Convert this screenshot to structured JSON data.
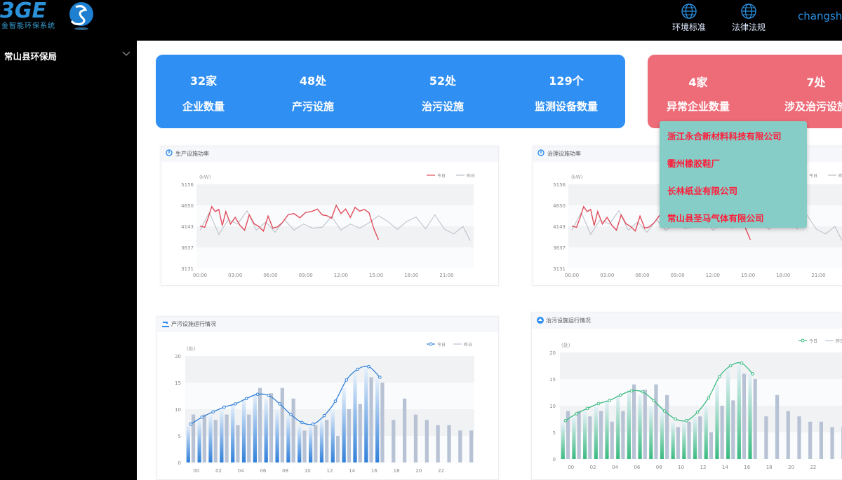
{
  "brand": {
    "logo_text": "3GE",
    "subtitle": "金智能环保系统"
  },
  "header": {
    "nav": [
      {
        "label": "环境标准",
        "icon": "globe-icon"
      },
      {
        "label": "法律法规",
        "icon": "globe-icon"
      }
    ],
    "user": "changsha"
  },
  "sidebar": {
    "items": [
      {
        "label": "常山县环保局",
        "icon": "chevron-down-icon"
      }
    ]
  },
  "summary": {
    "stats": [
      {
        "value": "32家",
        "label": "企业数量"
      },
      {
        "value": "48处",
        "label": "产污设施"
      },
      {
        "value": "52处",
        "label": "治污设施"
      },
      {
        "value": "129个",
        "label": "监测设备数量"
      }
    ],
    "alerts": [
      {
        "value": "4家",
        "label": "异常企业数量"
      },
      {
        "value": "7处",
        "label": "涉及治污设施"
      }
    ],
    "blue_color": "#2f8ff2",
    "red_color": "#ee6b78"
  },
  "abnormal_popup": {
    "items": [
      "浙江永合新材料科技有限公司",
      "衢州橡胶鞋厂",
      "长林纸业有限公司",
      "常山县圣马气体有限公司"
    ],
    "bg_color": "#86cdc7",
    "text_color": "#ff1d3a"
  },
  "panels": [
    {
      "title": "生产设施功率"
    },
    {
      "title": "治理设施功率"
    },
    {
      "title": "产污设施运行情况"
    },
    {
      "title": "治污设施运行情况"
    }
  ],
  "chart_data": [
    {
      "type": "line",
      "ylabel": "(kW)",
      "yticks": [
        5156,
        4650,
        4143,
        3637,
        3131
      ],
      "ylim": [
        3131,
        5156
      ],
      "xticks": [
        "00:00",
        "03:00",
        "06:00",
        "09:00",
        "12:00",
        "15:00",
        "18:00",
        "21:00"
      ],
      "xlim": [
        -0.3,
        23.3
      ],
      "series": [
        {
          "name": "今日",
          "color": "#e04c5c",
          "x": [
            0,
            0.4,
            0.7,
            1,
            1.3,
            1.6,
            1.9,
            2.2,
            2.6,
            3,
            3.4,
            3.8,
            4.2,
            4.6,
            5,
            5.4,
            5.8,
            6.2,
            6.6,
            7,
            7.5,
            8,
            8.5,
            9,
            9.5,
            10,
            10.4,
            10.8,
            11.2,
            11.6,
            12,
            12.4,
            12.8,
            13.2,
            13.6,
            14,
            14.4,
            14.8,
            15.2
          ],
          "values": [
            4150,
            4120,
            4350,
            4620,
            4500,
            4550,
            4160,
            4500,
            4200,
            4360,
            4170,
            4050,
            4420,
            4210,
            4140,
            4030,
            4390,
            4100,
            4130,
            4230,
            4420,
            4450,
            4350,
            4480,
            4500,
            4560,
            4420,
            4400,
            4340,
            4650,
            4450,
            4560,
            4360,
            4600,
            4510,
            4550,
            4470,
            4090,
            3820
          ]
        },
        {
          "name": "昨日",
          "color": "#b9bec6",
          "x": [
            0,
            0.8,
            1.6,
            2.4,
            3.2,
            4,
            4.8,
            5.6,
            6.4,
            7.2,
            8,
            8.8,
            9.6,
            10.4,
            11.2,
            12,
            12.8,
            13.6,
            14.4,
            15.2,
            16,
            16.8,
            17.6,
            18.4,
            19.2,
            20,
            20.8,
            21.6,
            22.4,
            23
          ],
          "values": [
            4050,
            4480,
            3950,
            4300,
            4200,
            4520,
            4050,
            4250,
            4000,
            4300,
            4050,
            4200,
            4100,
            4120,
            4380,
            4050,
            4200,
            4100,
            4230,
            4400,
            4260,
            4070,
            4260,
            4370,
            4080,
            4420,
            4080,
            3960,
            4140,
            3800
          ]
        }
      ]
    },
    {
      "type": "line",
      "ylabel": "(kW)",
      "yticks": [
        5156,
        4650,
        4143,
        3637,
        3131
      ],
      "ylim": [
        3131,
        5156
      ],
      "xticks": [
        "00:00",
        "03:00",
        "06:00",
        "09:00",
        "12:00",
        "15:00",
        "18:00",
        "21:00"
      ],
      "xlim": [
        -0.3,
        23.3
      ],
      "series": [
        {
          "name": "今日",
          "color": "#e04c5c",
          "x": [
            0,
            0.4,
            0.7,
            1,
            1.3,
            1.6,
            1.9,
            2.2,
            2.6,
            3,
            3.4,
            3.8,
            4.2,
            4.6,
            5,
            5.4,
            5.8,
            6.2,
            6.6,
            7,
            7.5,
            8,
            8.5,
            9,
            9.5,
            10,
            10.4,
            10.8,
            11.2,
            11.6,
            12,
            12.4,
            12.8,
            13.2,
            13.6,
            14,
            14.4,
            14.8,
            15.2
          ],
          "values": [
            4150,
            4120,
            4350,
            4620,
            4500,
            4550,
            4160,
            4500,
            4200,
            4360,
            4170,
            4050,
            4420,
            4210,
            4140,
            4030,
            4390,
            4100,
            4130,
            4230,
            4420,
            4450,
            4350,
            4480,
            4500,
            4560,
            4420,
            4400,
            4340,
            4650,
            4450,
            4560,
            4360,
            4600,
            4510,
            4550,
            4470,
            4090,
            3820
          ]
        },
        {
          "name": "昨日",
          "color": "#b9bec6",
          "x": [
            0,
            0.8,
            1.6,
            2.4,
            3.2,
            4,
            4.8,
            5.6,
            6.4,
            7.2,
            8,
            8.8,
            9.6,
            10.4,
            11.2,
            12,
            12.8,
            13.6,
            14.4,
            15.2,
            16,
            16.8,
            17.6,
            18.4,
            19.2,
            20,
            20.8,
            21.6,
            22.4,
            23
          ],
          "values": [
            4050,
            4480,
            3950,
            4300,
            4200,
            4520,
            4050,
            4250,
            4000,
            4300,
            4050,
            4200,
            4100,
            4120,
            4380,
            4050,
            4200,
            4100,
            4230,
            4400,
            4260,
            4070,
            4260,
            4370,
            4080,
            4420,
            4080,
            3960,
            4140,
            3800
          ]
        }
      ]
    },
    {
      "type": "bar",
      "ylabel": "(处)",
      "yticks": [
        20,
        15,
        10,
        5,
        0
      ],
      "ylim": [
        0,
        20
      ],
      "xticks": [
        "00",
        "02",
        "04",
        "06",
        "08",
        "10",
        "12",
        "14",
        "16",
        "18",
        "20",
        "22"
      ],
      "series": [
        {
          "name": "今日",
          "color": "#2f7fd9",
          "values": [
            7,
            8,
            9,
            10,
            11,
            12,
            13,
            12,
            10,
            9,
            7,
            7,
            8,
            10,
            14,
            17,
            18,
            16
          ],
          "line": [
            7.2,
            8.5,
            9.5,
            10.4,
            11,
            12,
            12.8,
            12.6,
            11,
            9,
            7.5,
            7.2,
            8.8,
            11.5,
            15.5,
            17.5,
            18,
            16
          ]
        },
        {
          "name": "昨日",
          "color": "#b7c2d4",
          "values": [
            9,
            9,
            8,
            9,
            7,
            9,
            14,
            13,
            14,
            12,
            6,
            7,
            8,
            5,
            10,
            11,
            16,
            15,
            8,
            12,
            9,
            8,
            7,
            7,
            6,
            6
          ]
        }
      ]
    },
    {
      "type": "bar",
      "ylabel": "(处)",
      "yticks": [
        20,
        15,
        10,
        5,
        0
      ],
      "ylim": [
        0,
        20
      ],
      "xticks": [
        "00",
        "02",
        "04",
        "06",
        "08",
        "10",
        "12",
        "14",
        "16",
        "18",
        "20",
        "22"
      ],
      "series": [
        {
          "name": "今日",
          "color": "#3aba80",
          "values": [
            7,
            8,
            9,
            10,
            11,
            12,
            13,
            12,
            10,
            9,
            7,
            7,
            8,
            10,
            14,
            17,
            18,
            16
          ],
          "line": [
            7.2,
            8.5,
            9.5,
            10.4,
            11,
            12,
            12.8,
            12.6,
            11,
            9,
            7.5,
            7.2,
            8.8,
            11.5,
            15.5,
            17.5,
            18,
            16
          ]
        },
        {
          "name": "昨日",
          "color": "#b7c2d4",
          "values": [
            9,
            9,
            8,
            9,
            7,
            9,
            14,
            13,
            14,
            12,
            6,
            7,
            8,
            5,
            10,
            11,
            16,
            15,
            8,
            12,
            9,
            8,
            7,
            7,
            6,
            6
          ]
        }
      ]
    }
  ]
}
